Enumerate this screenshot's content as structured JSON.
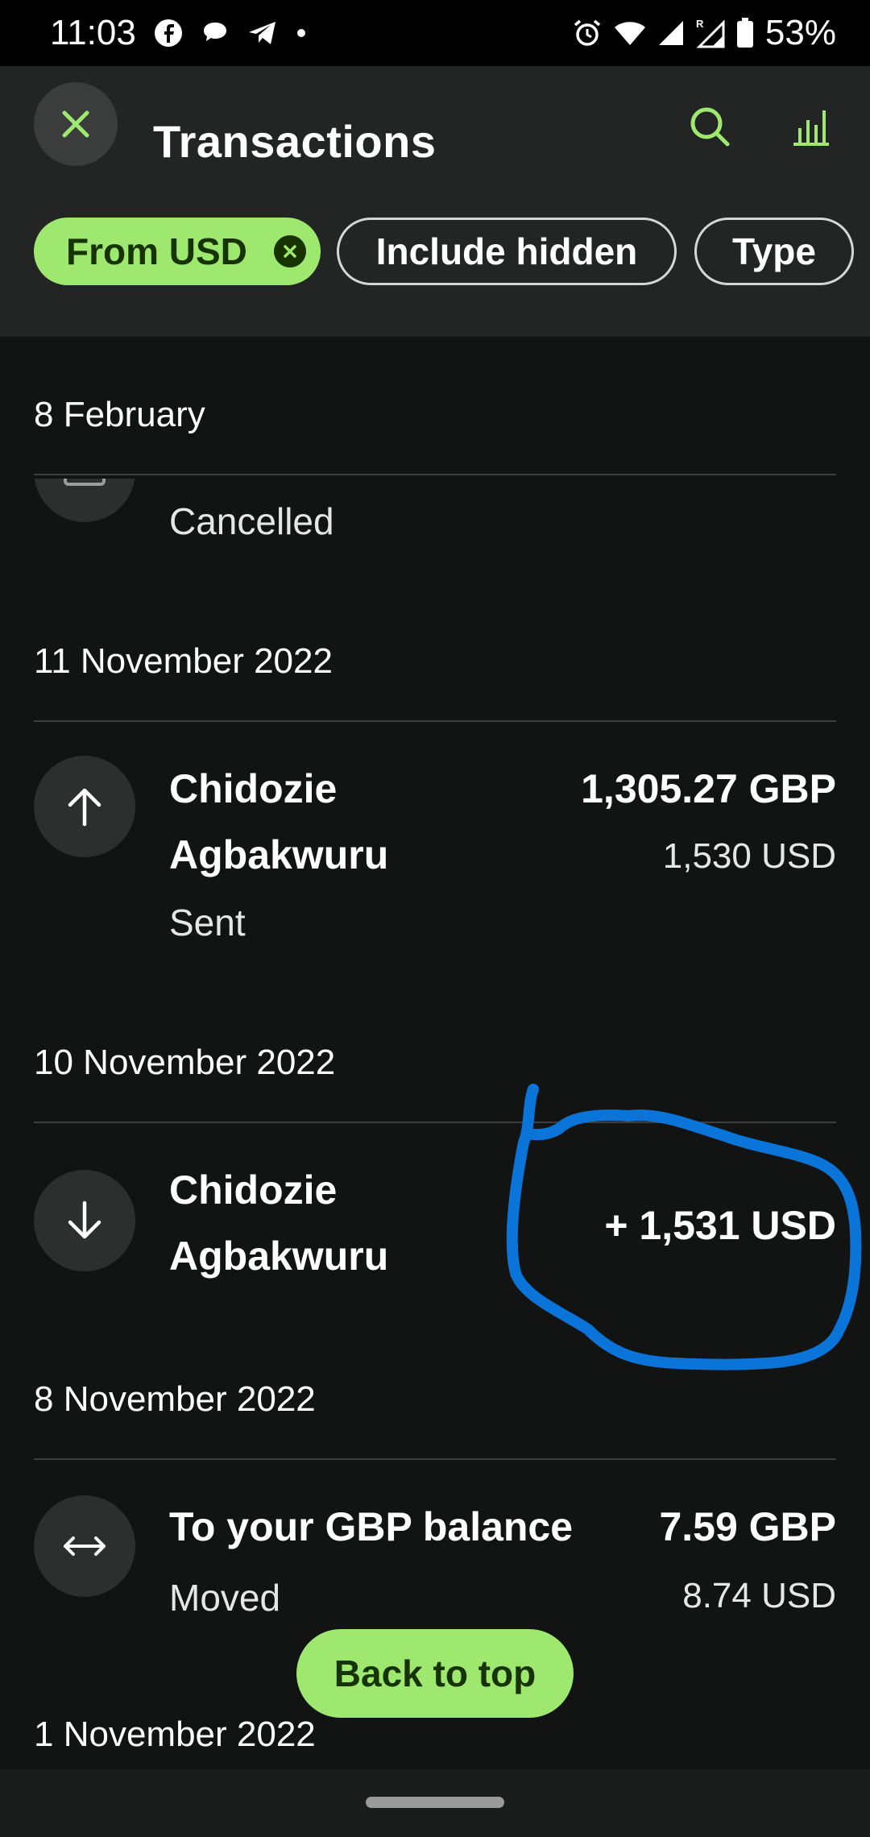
{
  "status_bar": {
    "time": "11:03",
    "battery": "53%",
    "left_icons": [
      "facebook-icon",
      "chat-bubble-icon",
      "telegram-icon",
      "dot-icon"
    ],
    "right_icons": [
      "alarm-icon",
      "wifi-icon",
      "signal-icon",
      "signal-roaming-icon",
      "battery-icon"
    ]
  },
  "header": {
    "title": "Transactions",
    "icons": [
      "close-icon",
      "search-icon",
      "bar-chart-icon"
    ]
  },
  "filters": [
    {
      "label": "From USD",
      "active": true
    },
    {
      "label": "Include hidden",
      "active": false
    },
    {
      "label": "Type",
      "active": false
    }
  ],
  "groups": [
    {
      "date": "8 February",
      "transactions": [
        {
          "status": "Cancelled",
          "icon": "card-icon"
        }
      ]
    },
    {
      "date": "11 November 2022",
      "transactions": [
        {
          "name_line1": "Chidozie",
          "name_line2": "Agbakwuru",
          "status": "Sent",
          "amount": "1,305.27 GBP",
          "sub_amount": "1,530 USD",
          "icon": "arrow-up-icon"
        }
      ]
    },
    {
      "date": "10 November 2022",
      "transactions": [
        {
          "name_line1": "Chidozie",
          "name_line2": "Agbakwuru",
          "amount": "+ 1,531 USD",
          "icon": "arrow-down-icon"
        }
      ]
    },
    {
      "date": "8 November 2022",
      "transactions": [
        {
          "name": "To your GBP balance",
          "status": "Moved",
          "amount": "7.59 GBP",
          "sub_amount": "8.74 USD",
          "icon": "arrows-left-right-icon"
        }
      ]
    },
    {
      "date": "1 November 2022",
      "transactions": []
    }
  ],
  "back_to_top": "Back to top",
  "colors": {
    "accent_green": "#9fe870",
    "dark_green": "#163300",
    "background": "#121413",
    "header_bg": "#222524",
    "annotation_blue": "#0a74d8"
  }
}
